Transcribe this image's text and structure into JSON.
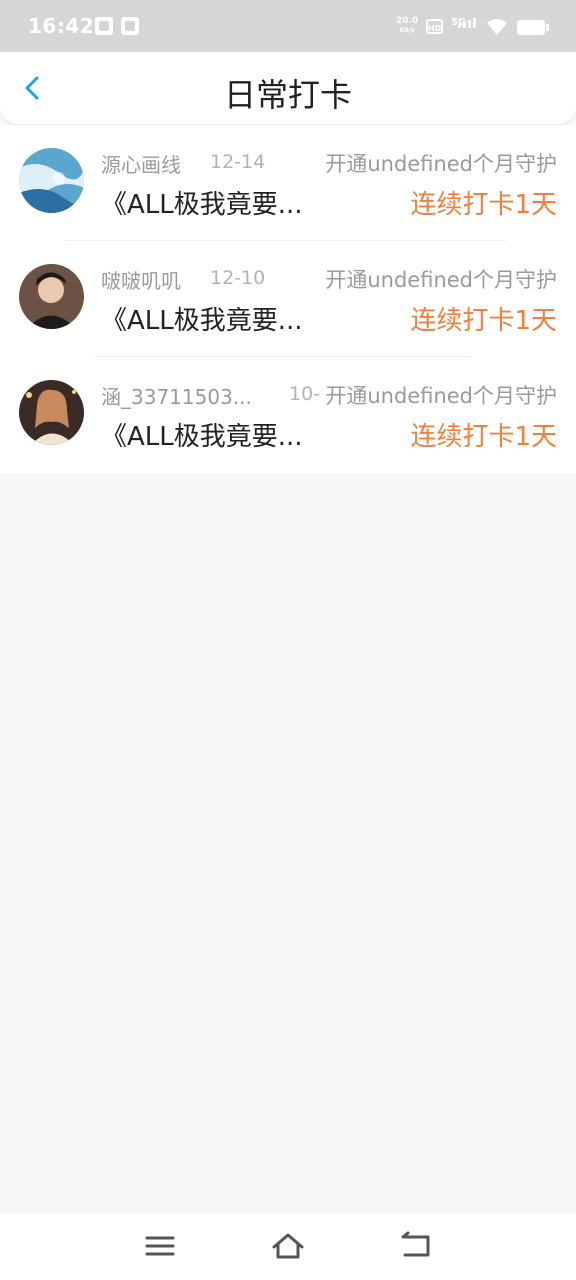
{
  "status_bar": {
    "time": "16:42",
    "net_speed": "20.0",
    "net_speed_unit": "KB/s",
    "hd": "HD",
    "network": "5G"
  },
  "header": {
    "title": "日常打卡"
  },
  "list": [
    {
      "user_name": "源心画线",
      "date": "12-14",
      "guard": "开通undefined个月守护",
      "work_title": "《ALL极我竟要...",
      "streak": "连续打卡1天"
    },
    {
      "user_name": "啵啵叽叽",
      "date": "12-10",
      "guard": "开通undefined个月守护",
      "work_title": "《ALL极我竟要...",
      "streak": "连续打卡1天"
    },
    {
      "user_name": "涵_33711503...",
      "date": "10-",
      "guard": "开通undefined个月守护",
      "work_title": "《ALL极我竟要...",
      "streak": "连续打卡1天"
    }
  ],
  "colors": {
    "accent": "#1da1e8",
    "streak": "#f0803c",
    "status_bar": "#d6d6d6",
    "background": "#f8f7f8"
  },
  "icons": {
    "back": "chevron-left-icon",
    "menu": "menu-icon",
    "home": "home-icon",
    "back_nav": "back-arrow-icon"
  }
}
